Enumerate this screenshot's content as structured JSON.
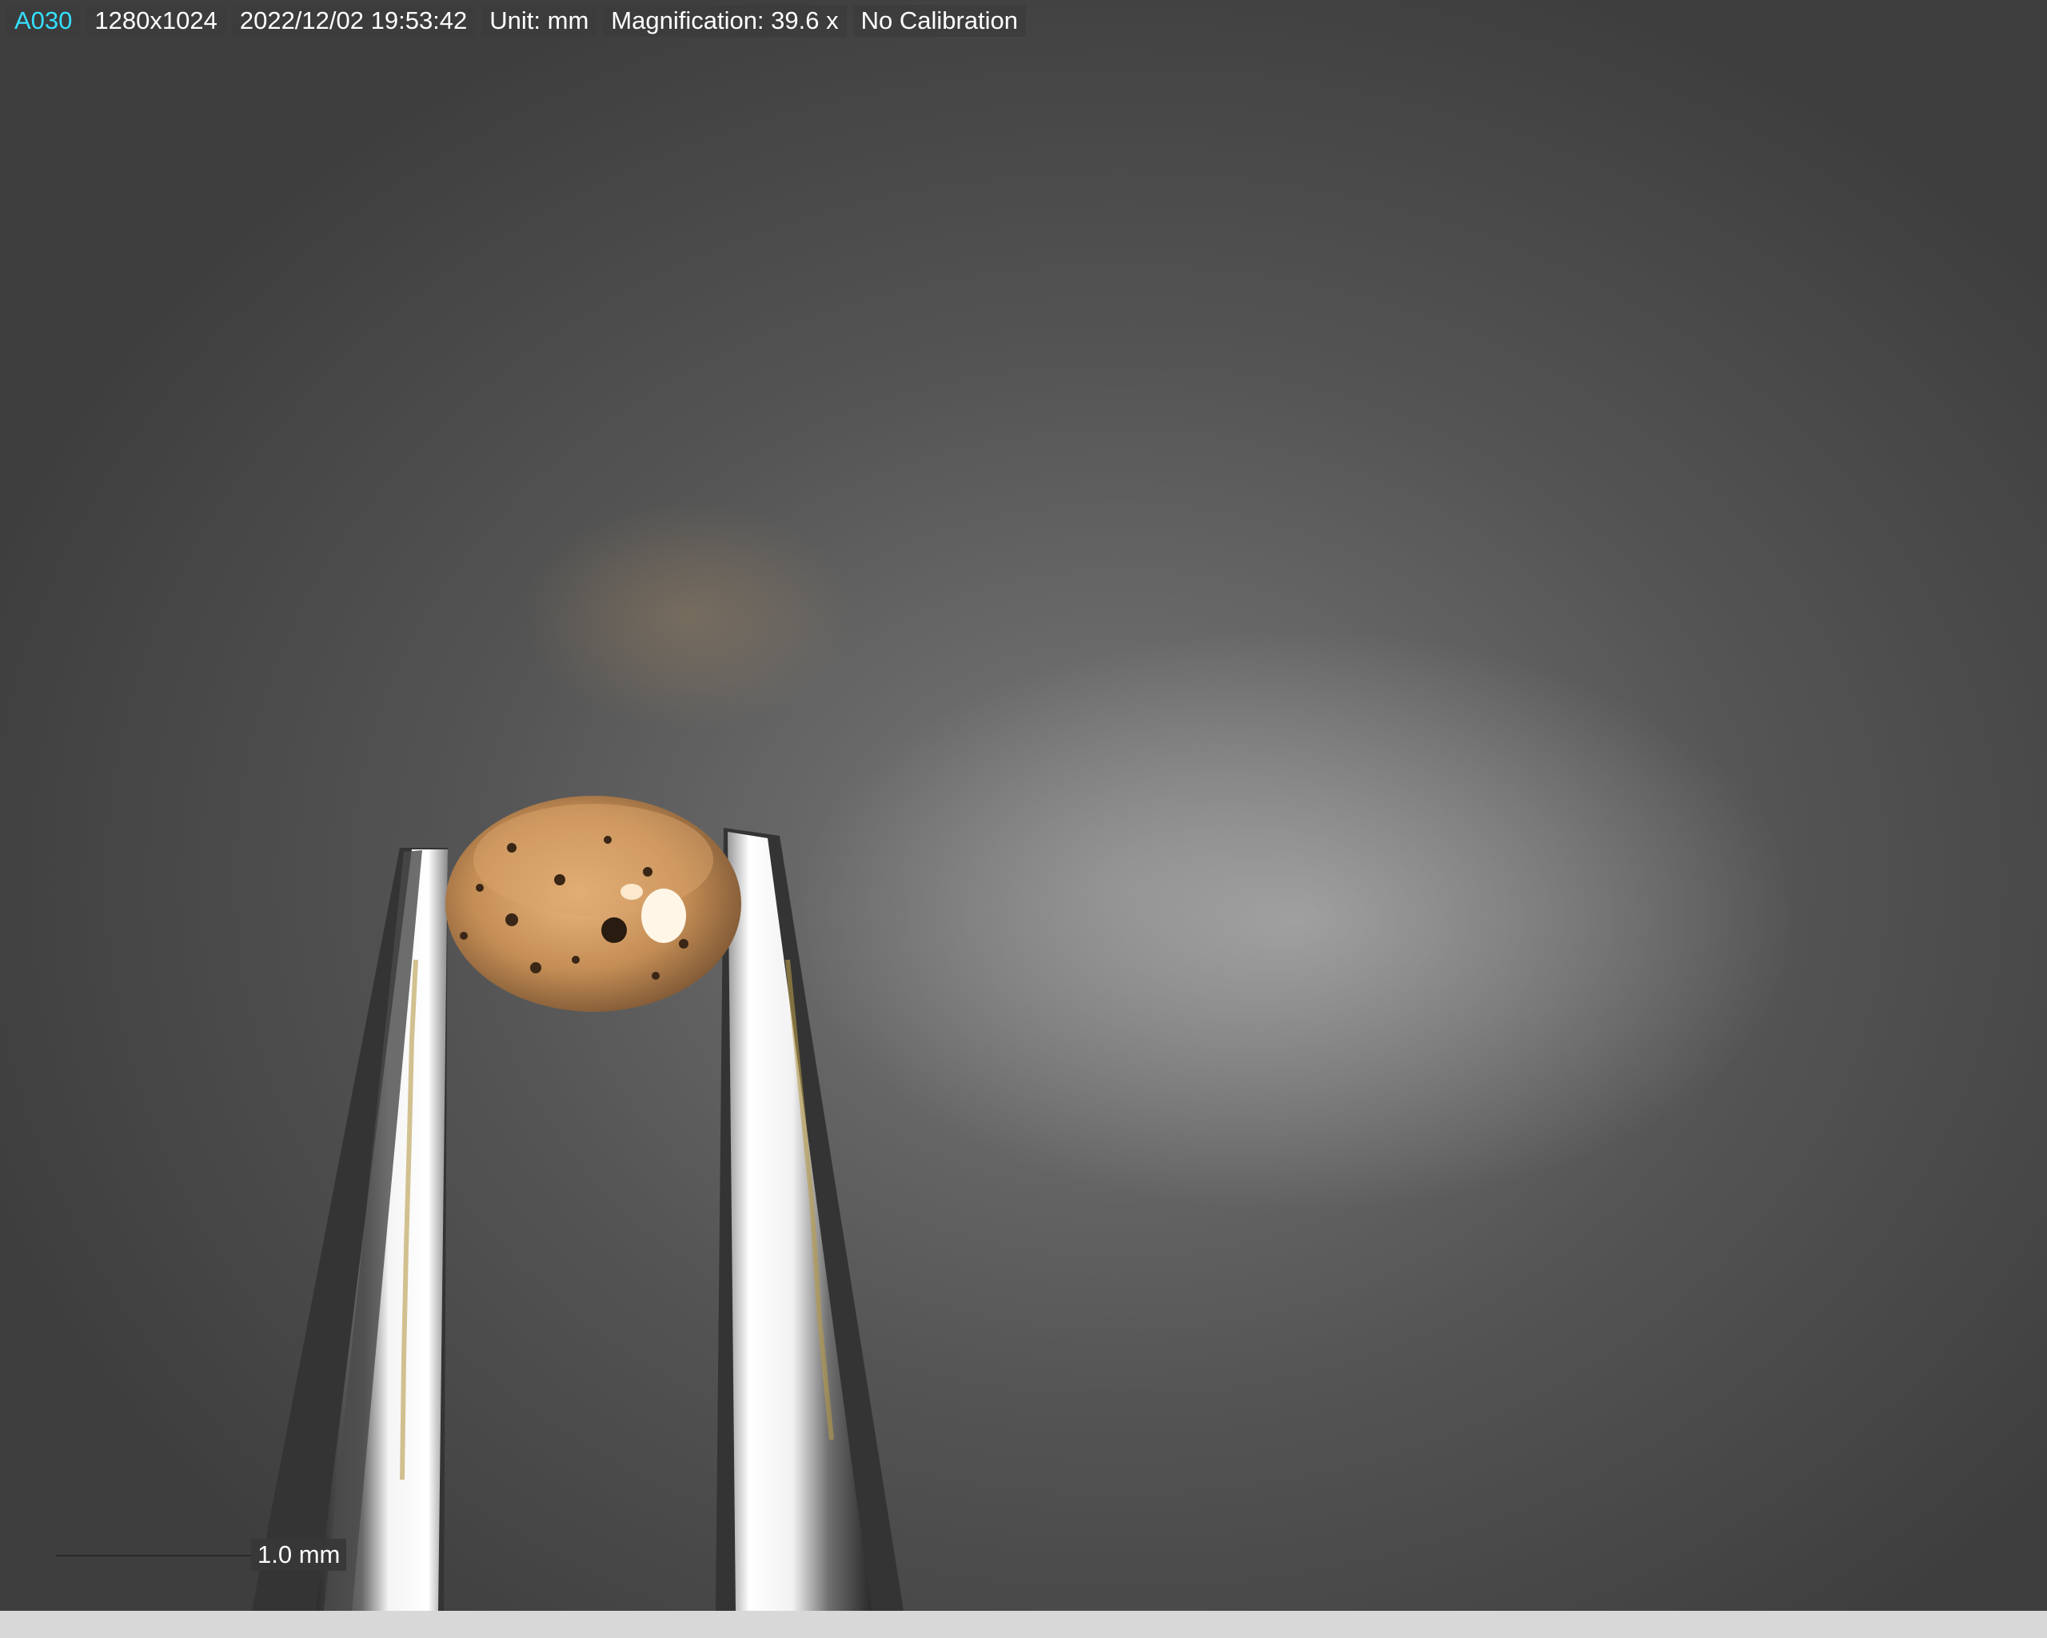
{
  "overlay": {
    "camera_id": "A030",
    "resolution": "1280x1024",
    "timestamp": "2022/12/02 19:53:42",
    "unit": "Unit: mm",
    "magnification": "Magnification:  39.6 x",
    "calibration": "No Calibration"
  },
  "scale_bar": {
    "label": "1.0 mm"
  },
  "colors": {
    "camera_id_text": "#34e0ff",
    "overlay_background": "#3c3c3c",
    "background": "#545454"
  }
}
